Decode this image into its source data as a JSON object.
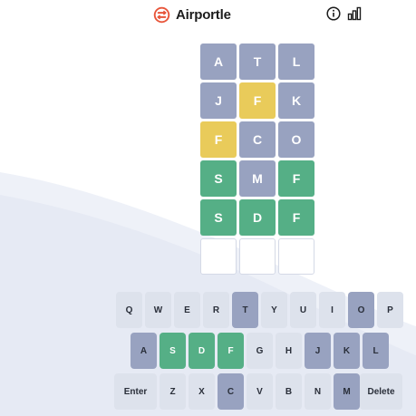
{
  "header": {
    "title": "Airportle",
    "logo_icon": "airportle-logo-icon",
    "info_icon": "info-icon",
    "stats_icon": "stats-bar-chart-icon"
  },
  "colors": {
    "absent": "#98a2c0",
    "present": "#e9cb5a",
    "correct": "#55af86",
    "key_default": "#dde2ec",
    "logo": "#e8553a"
  },
  "board": {
    "rows": [
      [
        {
          "letter": "A",
          "state": "absent"
        },
        {
          "letter": "T",
          "state": "absent"
        },
        {
          "letter": "L",
          "state": "absent"
        }
      ],
      [
        {
          "letter": "J",
          "state": "absent"
        },
        {
          "letter": "F",
          "state": "present"
        },
        {
          "letter": "K",
          "state": "absent"
        }
      ],
      [
        {
          "letter": "F",
          "state": "present"
        },
        {
          "letter": "C",
          "state": "absent"
        },
        {
          "letter": "O",
          "state": "absent"
        }
      ],
      [
        {
          "letter": "S",
          "state": "correct"
        },
        {
          "letter": "M",
          "state": "absent"
        },
        {
          "letter": "F",
          "state": "correct"
        }
      ],
      [
        {
          "letter": "S",
          "state": "correct"
        },
        {
          "letter": "D",
          "state": "correct"
        },
        {
          "letter": "F",
          "state": "correct"
        }
      ],
      [
        {
          "letter": "",
          "state": "empty"
        },
        {
          "letter": "",
          "state": "empty"
        },
        {
          "letter": "",
          "state": "empty"
        }
      ]
    ]
  },
  "keyboard": {
    "rows": [
      [
        {
          "label": "Q",
          "state": "unused"
        },
        {
          "label": "W",
          "state": "unused"
        },
        {
          "label": "E",
          "state": "unused"
        },
        {
          "label": "R",
          "state": "unused"
        },
        {
          "label": "T",
          "state": "absent"
        },
        {
          "label": "Y",
          "state": "unused"
        },
        {
          "label": "U",
          "state": "unused"
        },
        {
          "label": "I",
          "state": "unused"
        },
        {
          "label": "O",
          "state": "absent"
        },
        {
          "label": "P",
          "state": "unused"
        }
      ],
      [
        {
          "label": "A",
          "state": "absent"
        },
        {
          "label": "S",
          "state": "correct"
        },
        {
          "label": "D",
          "state": "correct"
        },
        {
          "label": "F",
          "state": "correct"
        },
        {
          "label": "G",
          "state": "unused"
        },
        {
          "label": "H",
          "state": "unused"
        },
        {
          "label": "J",
          "state": "absent"
        },
        {
          "label": "K",
          "state": "absent"
        },
        {
          "label": "L",
          "state": "absent"
        }
      ],
      [
        {
          "label": "Enter",
          "state": "unused"
        },
        {
          "label": "Z",
          "state": "unused"
        },
        {
          "label": "X",
          "state": "unused"
        },
        {
          "label": "C",
          "state": "absent"
        },
        {
          "label": "V",
          "state": "unused"
        },
        {
          "label": "B",
          "state": "unused"
        },
        {
          "label": "N",
          "state": "unused"
        },
        {
          "label": "M",
          "state": "absent"
        },
        {
          "label": "Delete",
          "state": "unused"
        }
      ]
    ]
  }
}
